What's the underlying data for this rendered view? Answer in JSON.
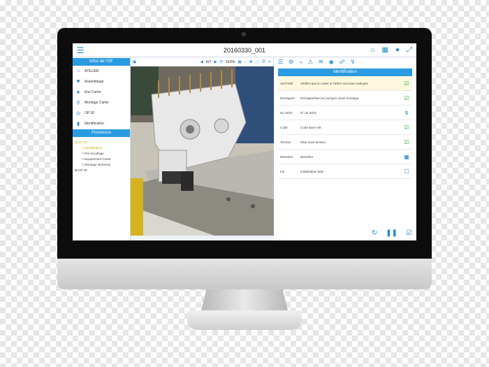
{
  "app": {
    "title": "20160330_001",
    "menu_icon": "hamburger-icon",
    "top_icons": [
      "home-icon",
      "grid-icon",
      "user-icon",
      "expand-icon"
    ]
  },
  "colors": {
    "accent": "#2a9be0",
    "check": "#2eaa4a",
    "highlight": "#fff8df",
    "bezel": "#0d0d0d"
  },
  "left": {
    "header": "Infos de l'OF",
    "items": [
      {
        "icon": "home-icon",
        "label": "ATELIER"
      },
      {
        "icon": "cube-icon",
        "label": "Assemblage"
      },
      {
        "icon": "star-icon",
        "label": "Ens Carter"
      },
      {
        "icon": "pin-icon",
        "label": "Montage Carter"
      },
      {
        "icon": "target-icon",
        "label": "OP 30"
      },
      {
        "icon": "bookmark-icon",
        "label": "Identification"
      }
    ],
    "process_header": "Processus",
    "tree": [
      {
        "label": "OP 30",
        "level": 0,
        "selected": true
      },
      {
        "label": "Identification",
        "level": 1,
        "selected": true
      },
      {
        "label": "Pré-encollage",
        "level": 1,
        "selected": false
      },
      {
        "label": "Equipement Carter",
        "level": 1,
        "selected": false
      },
      {
        "label": "Montage elements",
        "level": 1,
        "selected": false
      },
      {
        "label": "OP 40",
        "level": 0,
        "selected": false
      }
    ]
  },
  "viewer": {
    "page": "6/7",
    "zoom": "110%"
  },
  "right": {
    "header": "Identification",
    "rows": [
      {
        "name": "Verif Nett",
        "desc": "Vérifier que le carter et l'arbre sont bien nettoyés",
        "status": "checked",
        "highlight": true
      },
      {
        "name": "Demagnet",
        "desc": "Demagnétiser les pompes avant montage",
        "status": "checked",
        "highlight": false
      },
      {
        "name": "No Série",
        "desc": "N° de Série",
        "status": "lightning",
        "highlight": false
      },
      {
        "name": "Code",
        "desc": "Code barre OK",
        "status": "checked",
        "highlight": false
      },
      {
        "name": "Tension",
        "desc": "Mise sous tension",
        "status": "checked",
        "highlight": false
      },
      {
        "name": "Diamètre",
        "desc": "Diamètre",
        "status": "calculator",
        "highlight": false
      },
      {
        "name": "Init",
        "desc": "Initialisation faite",
        "status": "unchecked",
        "highlight": false
      }
    ]
  }
}
